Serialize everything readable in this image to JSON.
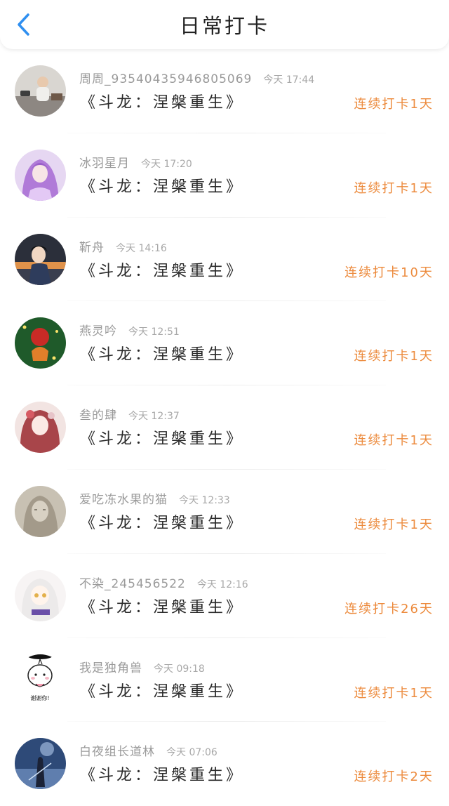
{
  "header": {
    "title": "日常打卡",
    "back_icon": "chevron-left-icon",
    "accent_color": "#2f8ff0"
  },
  "streak_color": "#ec8a3c",
  "items": [
    {
      "username": "周周_93540435946805069",
      "time": "今天 17:44",
      "book": "《斗龙：涅槃重生》",
      "streak": "连续打卡1天"
    },
    {
      "username": "冰羽星月",
      "time": "今天 17:20",
      "book": "《斗龙：涅槃重生》",
      "streak": "连续打卡1天"
    },
    {
      "username": "靳舟",
      "time": "今天 14:16",
      "book": "《斗龙：涅槃重生》",
      "streak": "连续打卡10天"
    },
    {
      "username": "燕灵吟",
      "time": "今天 12:51",
      "book": "《斗龙：涅槃重生》",
      "streak": "连续打卡1天"
    },
    {
      "username": "叁的肆",
      "time": "今天 12:37",
      "book": "《斗龙：涅槃重生》",
      "streak": "连续打卡1天"
    },
    {
      "username": "爱吃冻水果的猫",
      "time": "今天 12:33",
      "book": "《斗龙：涅槃重生》",
      "streak": "连续打卡1天"
    },
    {
      "username": "不染_245456522",
      "time": "今天 12:16",
      "book": "《斗龙：涅槃重生》",
      "streak": "连续打卡26天"
    },
    {
      "username": "我是独角兽",
      "time": "今天 09:18",
      "book": "《斗龙：涅槃重生》",
      "streak": "连续打卡1天",
      "avatar_caption": "谢谢你!"
    },
    {
      "username": "白夜组长道林",
      "time": "今天 07:06",
      "book": "《斗龙：涅槃重生》",
      "streak": "连续打卡2天"
    }
  ]
}
